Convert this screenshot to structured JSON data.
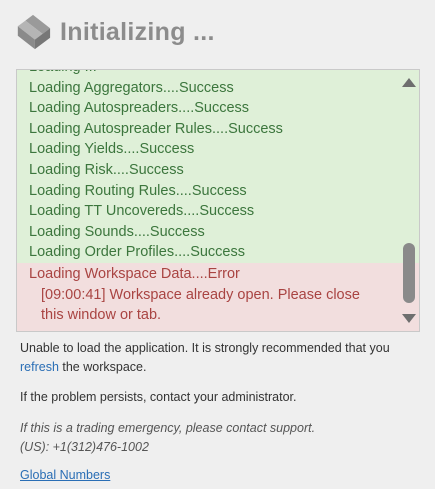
{
  "header": {
    "title": "Initializing ...",
    "logo_icon": "tt-logo-icon"
  },
  "log": {
    "partial_top": "Loading ...",
    "success_lines": [
      "Loading Aggregators....Success",
      "Loading Autospreaders....Success",
      "Loading Autospreader Rules....Success",
      "Loading Yields....Success",
      "Loading Risk....Success",
      "Loading Routing Rules....Success",
      "Loading TT Uncovereds....Success",
      "Loading Sounds....Success",
      "Loading Order Profiles....Success"
    ],
    "error_line": "Loading Workspace Data....Error",
    "error_detail": "[09:00:41] Workspace already open. Please close this window or tab.",
    "colors": {
      "success_bg": "#dff0d8",
      "success_text": "#3c763d",
      "error_bg": "#f2dede",
      "error_text": "#a94442"
    }
  },
  "messages": {
    "unable_prefix": "Unable to load the application. It is strongly recommended that you ",
    "refresh_link": "refresh",
    "unable_suffix": " the workspace.",
    "persists": "If the problem persists, contact your administrator.",
    "emergency": "If this is a trading emergency, please contact support.",
    "phone": "(US): +1(312)476-1002",
    "global_numbers": "Global Numbers"
  }
}
